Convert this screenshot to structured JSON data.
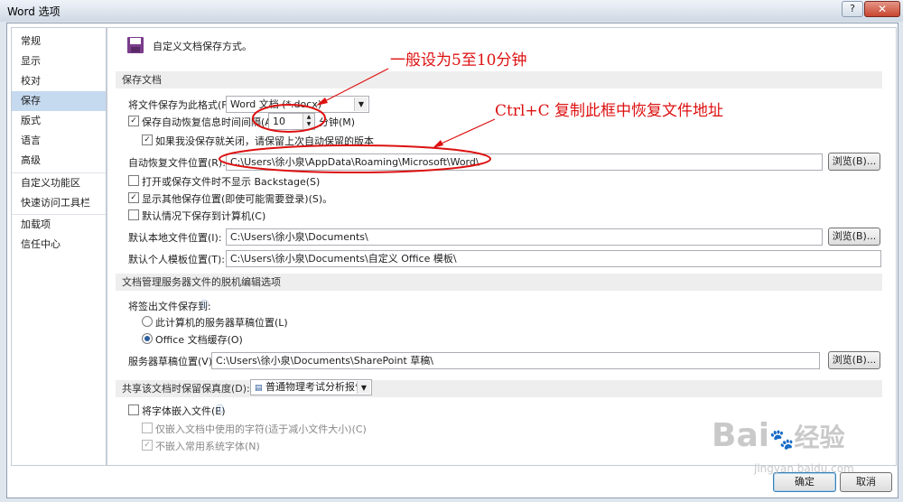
{
  "window": {
    "title": "Word 选项",
    "help": "?",
    "close": "✕"
  },
  "sidebar": {
    "items": [
      {
        "label": "常规"
      },
      {
        "label": "显示"
      },
      {
        "label": "校对"
      },
      {
        "label": "保存",
        "active": true
      },
      {
        "label": "版式"
      },
      {
        "label": "语言"
      },
      {
        "label": "高级"
      },
      {
        "label": "自定义功能区"
      },
      {
        "label": "快速访问工具栏"
      },
      {
        "label": "加载项"
      },
      {
        "label": "信任中心"
      }
    ]
  },
  "header": {
    "icon": "floppy-disk-icon",
    "text": "自定义文档保存方式。"
  },
  "save_section": {
    "title": "保存文档",
    "format_label": "将文件保存为此格式(F):",
    "format_value": "Word 文档 (*.docx)",
    "autorecover_label": "保存自动恢复信息时间间隔(A)",
    "autorecover_checked": true,
    "autorecover_minutes": "10",
    "minutes_label": "分钟(M)",
    "keep_last_label": "如果我没保存就关闭，请保留上次自动保留的版本",
    "keep_last_checked": true,
    "autorecover_location_label": "自动恢复文件位置(R):",
    "autorecover_location_value": "C:\\Users\\徐小泉\\AppData\\Roaming\\Microsoft\\Word\\",
    "browse_label": "浏览(B)...",
    "no_backstage_label": "打开或保存文件时不显示 Backstage(S)",
    "no_backstage_checked": false,
    "show_additional_label": "显示其他保存位置(即使可能需要登录)(S)。",
    "show_additional_checked": true,
    "save_computer_label": "默认情况下保存到计算机(C)",
    "save_computer_checked": false,
    "local_location_label": "默认本地文件位置(I):",
    "local_location_value": "C:\\Users\\徐小泉\\Documents\\",
    "template_location_label": "默认个人模板位置(T):",
    "template_location_value": "C:\\Users\\徐小泉\\Documents\\自定义 Office 模板\\"
  },
  "server_section": {
    "title": "文档管理服务器文件的脱机编辑选项",
    "checkout_label": "将签出文件保存到:",
    "option_server": "此计算机的服务器草稿位置(L)",
    "option_cache": "Office 文档缓存(O)",
    "selected": "cache",
    "drafts_label": "服务器草稿位置(V):",
    "drafts_value": "C:\\Users\\徐小泉\\Documents\\SharePoint 草稿\\",
    "browse_label": "浏览(B)..."
  },
  "fidelity_section": {
    "title": "共享该文档时保留保真度(D):",
    "document": "普通物理考试分析报告",
    "embed_fonts_label": "将字体嵌入文件(E)",
    "embed_fonts_checked": false,
    "embed_used_label": "仅嵌入文档中使用的字符(适于减小文件大小)(C)",
    "embed_used_checked": false,
    "no_common_label": "不嵌入常用系统字体(N)",
    "no_common_checked": true
  },
  "footer": {
    "ok": "确定",
    "cancel": "取消"
  },
  "annotations": {
    "note1": "一般设为5至10分钟",
    "note2": "Ctrl+C 复制此框中恢复文件地址",
    "color": "#dd1111"
  },
  "watermark": {
    "brand": "Bai",
    "brand2": "经验",
    "url": "jingyan.baidu.com"
  }
}
